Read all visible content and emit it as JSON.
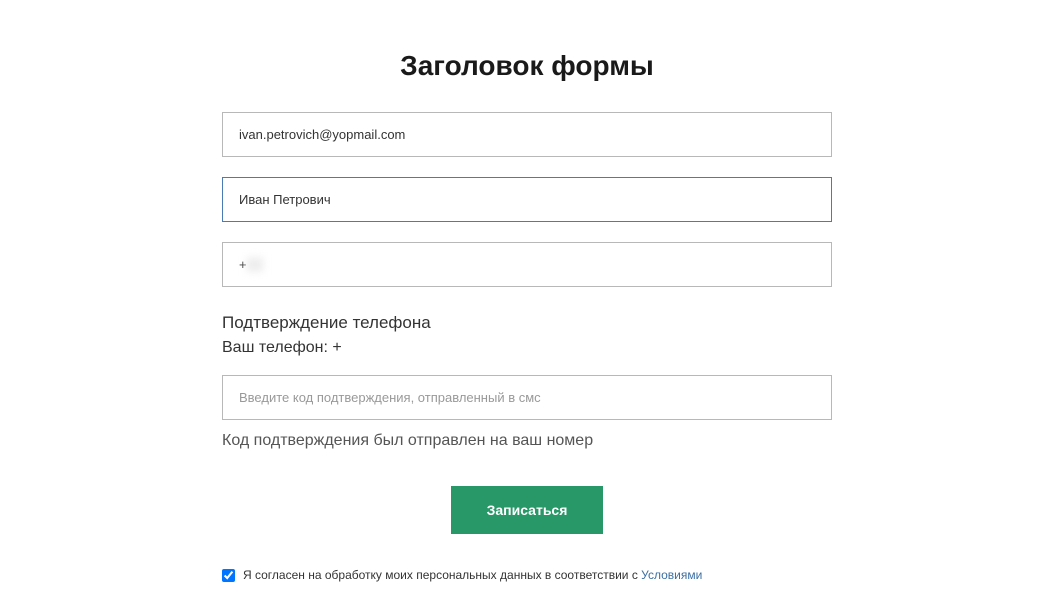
{
  "form": {
    "title": "Заголовок формы",
    "email": {
      "value": "ivan.petrovich@yopmail.com"
    },
    "name": {
      "value": "Иван Петрович"
    },
    "phone": {
      "prefix": "+",
      "masked_value": "  -     -  "
    },
    "confirmation": {
      "subtitle": "Подтверждение телефона",
      "your_phone_label": "Ваш телефон: +",
      "your_phone_masked": "            ",
      "code_placeholder": "Введите код подтверждения, отправленный в смс",
      "status_text": "Код подтверждения был отправлен на ваш номер"
    },
    "submit_label": "Записаться",
    "consent": {
      "checked": true,
      "text": "Я согласен на обработку моих персональных данных в соответствии с ",
      "link_text": "Условиями"
    }
  }
}
